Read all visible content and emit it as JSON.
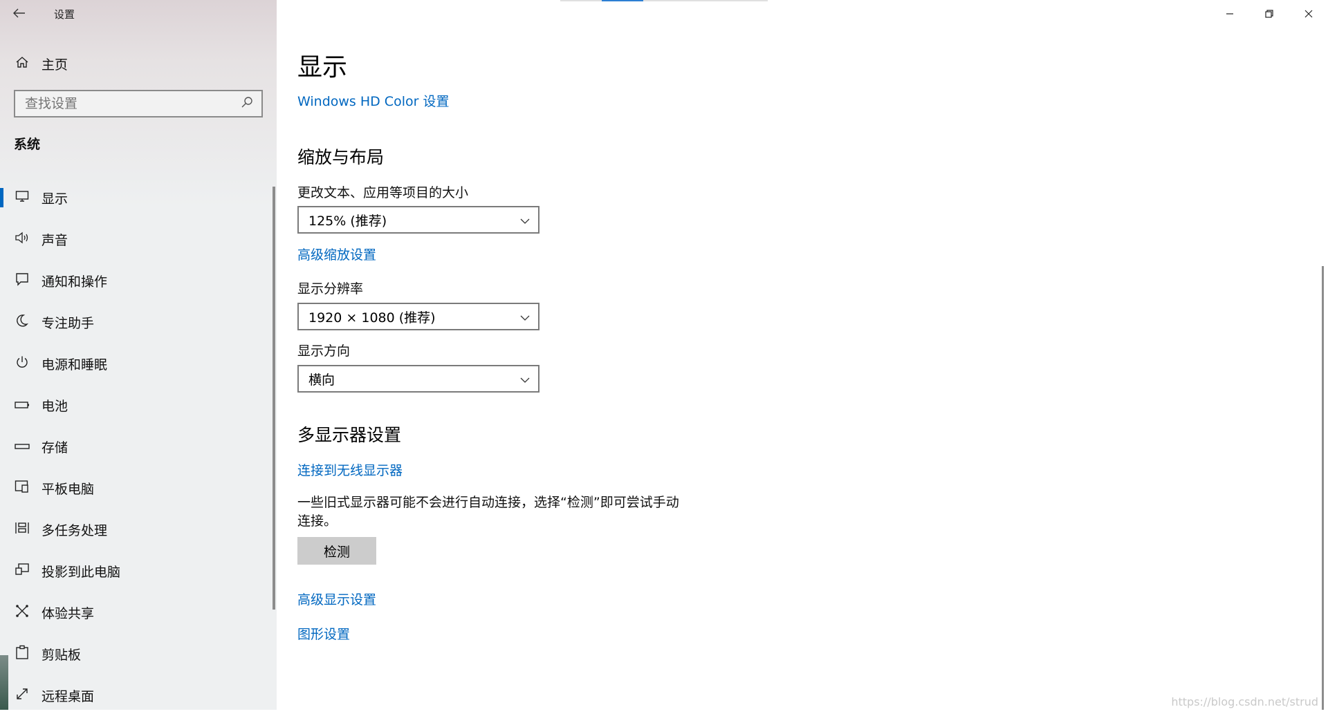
{
  "window": {
    "title": "设置",
    "controls": {
      "minimize": "—",
      "restore": "❐",
      "close": "✕"
    }
  },
  "sidebar": {
    "back_icon": "back-arrow-icon",
    "home_label": "主页",
    "search_placeholder": "查找设置",
    "section_label": "系统",
    "items": [
      {
        "label": "显示",
        "icon": "monitor-icon",
        "active": true
      },
      {
        "label": "声音",
        "icon": "speaker-icon"
      },
      {
        "label": "通知和操作",
        "icon": "notification-icon"
      },
      {
        "label": "专注助手",
        "icon": "moon-icon"
      },
      {
        "label": "电源和睡眠",
        "icon": "power-icon"
      },
      {
        "label": "电池",
        "icon": "battery-icon"
      },
      {
        "label": "存储",
        "icon": "storage-icon"
      },
      {
        "label": "平板电脑",
        "icon": "tablet-icon"
      },
      {
        "label": "多任务处理",
        "icon": "multitask-icon"
      },
      {
        "label": "投影到此电脑",
        "icon": "project-icon"
      },
      {
        "label": "体验共享",
        "icon": "share-icon"
      },
      {
        "label": "剪贴板",
        "icon": "clipboard-icon"
      },
      {
        "label": "远程桌面",
        "icon": "remote-desktop-icon"
      }
    ]
  },
  "main": {
    "title": "显示",
    "hd_color_link": "Windows HD Color 设置",
    "scale_section": {
      "heading": "缩放与布局",
      "scale_label": "更改文本、应用等项目的大小",
      "scale_value": "125% (推荐)",
      "advanced_scale_link": "高级缩放设置",
      "resolution_label": "显示分辨率",
      "resolution_value": "1920 × 1080 (推荐)",
      "orientation_label": "显示方向",
      "orientation_value": "横向"
    },
    "multi_section": {
      "heading": "多显示器设置",
      "wireless_link": "连接到无线显示器",
      "description": "一些旧式显示器可能不会进行自动连接，选择“检测”即可尝试手动连接。",
      "detect_button": "检测",
      "advanced_display_link": "高级显示设置",
      "graphics_link": "图形设置"
    }
  },
  "watermark": "https://blog.csdn.net/strud",
  "colors": {
    "accent": "#0067c0",
    "sidebar_bg": "#eef0f1",
    "button_bg": "#cccccc"
  }
}
